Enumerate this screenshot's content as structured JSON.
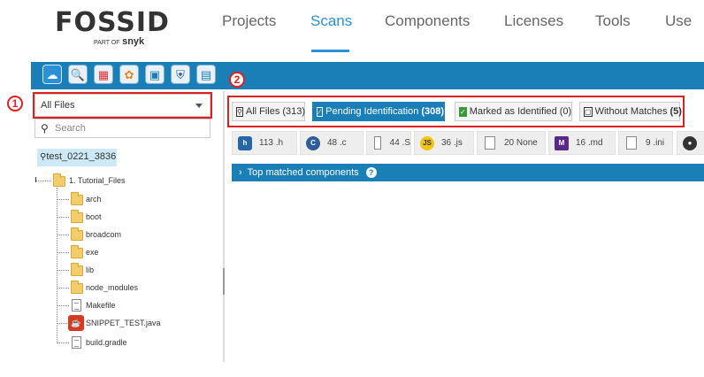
{
  "brand": {
    "name": "FOSSID",
    "sub_prefix": "PART OF",
    "sub_brand": "snyk"
  },
  "nav": {
    "items": [
      {
        "label": "Projects",
        "active": false
      },
      {
        "label": "Scans",
        "active": true
      },
      {
        "label": "Components",
        "active": false
      },
      {
        "label": "Licenses",
        "active": false
      },
      {
        "label": "Tools",
        "active": false
      },
      {
        "label": "Use",
        "active": false
      }
    ]
  },
  "toolbar": {
    "icons": [
      "upload-icon",
      "search-icon",
      "tree-icon",
      "license-icon",
      "clipboard-icon",
      "shield-icon",
      "report-icon"
    ]
  },
  "annotations": {
    "one": "1",
    "two": "2"
  },
  "left_panel": {
    "file_filter": "All Files",
    "search_placeholder": "Search",
    "scan_name": "test_0221_3836",
    "tree": {
      "root": "1. Tutorial_Files",
      "children": [
        {
          "label": "arch",
          "type": "folder"
        },
        {
          "label": "boot",
          "type": "folder"
        },
        {
          "label": "broadcom",
          "type": "folder"
        },
        {
          "label": "exe",
          "type": "folder"
        },
        {
          "label": "lib",
          "type": "folder"
        },
        {
          "label": "node_modules",
          "type": "folder"
        },
        {
          "label": "Makefile",
          "type": "file"
        },
        {
          "label": "SNIPPET_TEST.java",
          "type": "java"
        },
        {
          "label": "build.gradle",
          "type": "file"
        }
      ]
    }
  },
  "filter_tabs": [
    {
      "label": "All Files",
      "count": "(313)",
      "active": false
    },
    {
      "label": "Pending Identification",
      "count": "(308)",
      "active": true
    },
    {
      "label": "Marked as Identified",
      "count": "(0)",
      "active": false
    },
    {
      "label": "Without Matches",
      "count": "(5)",
      "active": false
    }
  ],
  "extensions": [
    {
      "count": "113",
      "ext": ".h",
      "icon": "h-icon",
      "glyph": "h"
    },
    {
      "count": "48",
      "ext": ".c",
      "icon": "c-icon",
      "glyph": "C"
    },
    {
      "count": "44",
      "ext": ".S",
      "icon": "file-icon",
      "glyph": ""
    },
    {
      "count": "36",
      "ext": ".js",
      "icon": "js-icon",
      "glyph": "JS"
    },
    {
      "count": "20",
      "ext": "None",
      "icon": "file-icon",
      "glyph": ""
    },
    {
      "count": "16",
      "ext": ".md",
      "icon": "markdown-icon",
      "glyph": "M"
    },
    {
      "count": "9",
      "ext": ".ini",
      "icon": "file-icon",
      "glyph": ""
    }
  ],
  "top_components": {
    "label": "Top matched components",
    "help": "?"
  },
  "colors": {
    "accent": "#1a7fb7",
    "nav_active": "#2a91d6",
    "annotation": "#e02020"
  }
}
